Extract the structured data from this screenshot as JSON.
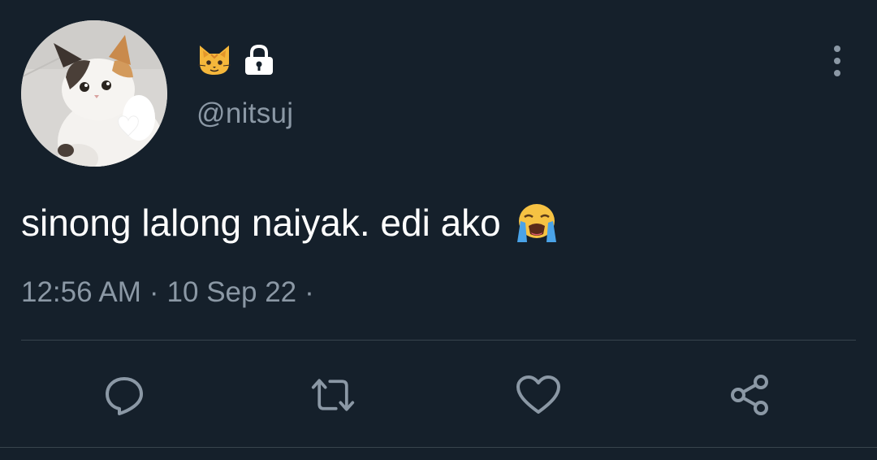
{
  "user": {
    "name_emoji": "cat-face-emoji",
    "protected_icon": "lock-icon",
    "handle": "@nitsuj",
    "avatar": "cat-avatar"
  },
  "tweet": {
    "text": "sinong lalong naiyak. edi ako",
    "emoji": "loudly-crying-face-emoji",
    "time": "12:56 AM",
    "separator": "·",
    "date": "10 Sep 22"
  },
  "actions": [
    {
      "icon": "reply-icon"
    },
    {
      "icon": "retweet-icon"
    },
    {
      "icon": "like-icon"
    },
    {
      "icon": "share-icon"
    }
  ],
  "colors": {
    "background": "#15202b",
    "text": "#ffffff",
    "secondary": "#8b98a5",
    "divider": "#38444d"
  }
}
